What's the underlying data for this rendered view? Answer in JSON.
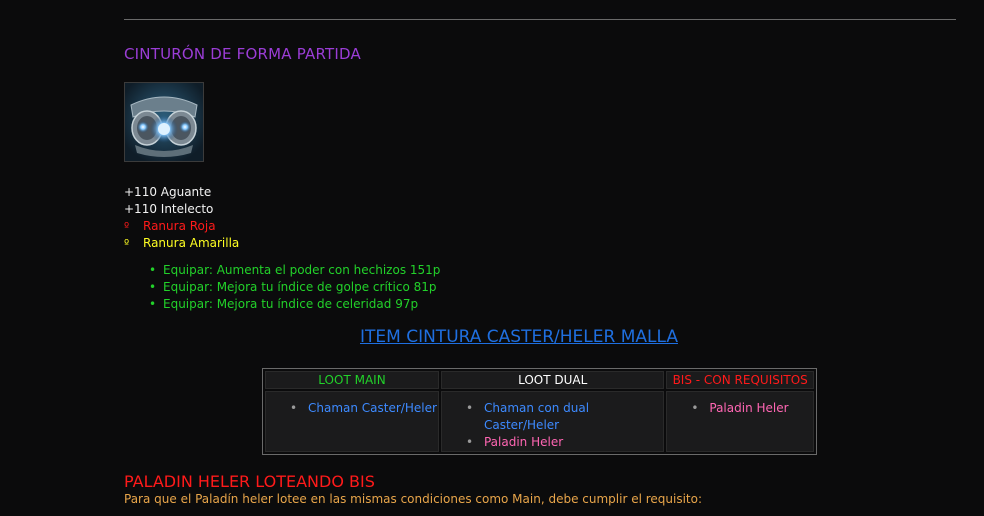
{
  "item": {
    "title": "CINTURÓN DE FORMA PARTIDA",
    "icon": "belt-icon",
    "stats": [
      "+110 Aguante",
      "+110 Intelecto"
    ],
    "sockets": [
      {
        "bullet": "º",
        "label": "Ranura Roja",
        "color": "#ff1a1a"
      },
      {
        "bullet": "º",
        "label": "Ranura Amarilla",
        "color": "#ffff22"
      }
    ],
    "equip": [
      "Equipar: Aumenta el poder con hechizos 151p",
      "Equipar: Mejora tu índice de golpe crítico 81p",
      "Equipar: Mejora tu índice de celeridad 97p"
    ]
  },
  "section": {
    "title": "ITEM CINTURA CASTER/HELER MALLA"
  },
  "loot_table": {
    "headers": [
      "LOOT MAIN",
      "LOOT DUAL",
      "BIS - CON REQUISITOS"
    ],
    "main": [
      "Chaman Caster/Heler"
    ],
    "dual": [
      "Chaman con dual Caster/Heler",
      "Paladin Heler"
    ],
    "bis": [
      "Paladin Heler"
    ]
  },
  "paladin": {
    "title": "PALADIN HELER LOTEANDO BIS",
    "text": "Para que el Paladín heler lotee en las mismas condiciones como Main, debe cumplir el requisito:"
  }
}
